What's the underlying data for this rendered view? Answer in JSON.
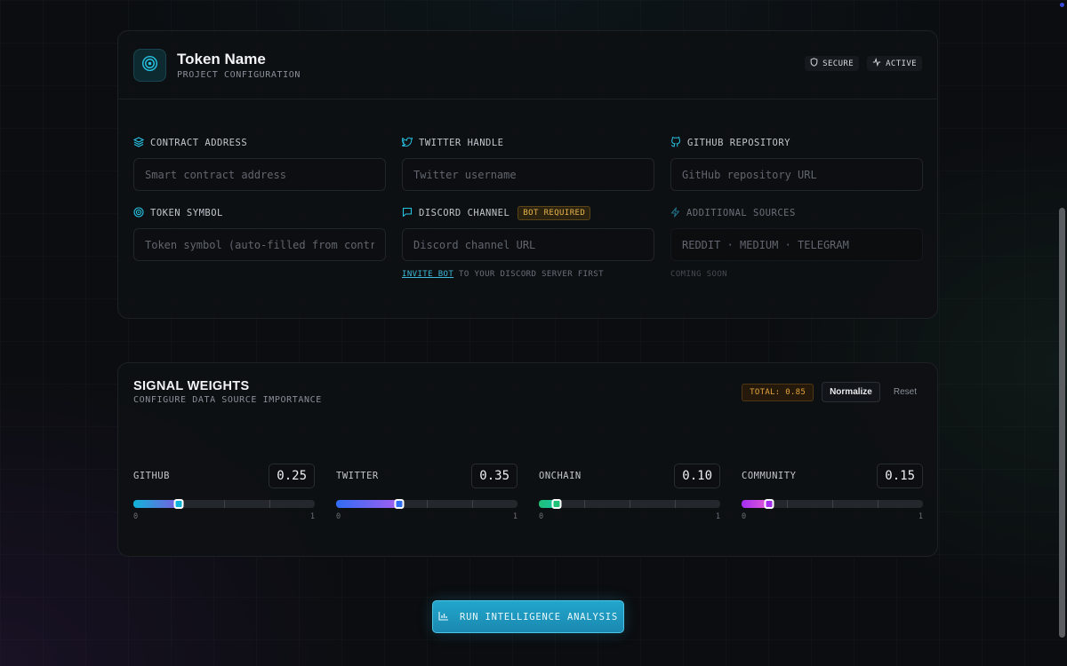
{
  "header": {
    "title": "Token Name",
    "subtitle": "PROJECT CONFIGURATION",
    "badges": [
      {
        "label": "SECURE",
        "icon": "shield-icon"
      },
      {
        "label": "ACTIVE",
        "icon": "activity-icon"
      }
    ]
  },
  "fields": {
    "contract": {
      "label": "CONTRACT ADDRESS",
      "placeholder": "Smart contract address",
      "icon": "layers-icon"
    },
    "twitter": {
      "label": "TWITTER HANDLE",
      "placeholder": "Twitter username",
      "icon": "twitter-icon"
    },
    "github": {
      "label": "GITHUB REPOSITORY",
      "placeholder": "GitHub repository URL",
      "icon": "github-icon"
    },
    "symbol": {
      "label": "TOKEN SYMBOL",
      "placeholder": "Token symbol (auto-filled from contract)",
      "icon": "target-icon"
    },
    "discord": {
      "label": "DISCORD CHANNEL",
      "badge": "BOT REQUIRED",
      "placeholder": "Discord channel URL",
      "icon": "message-icon",
      "hint_link": "INVITE BOT",
      "hint_text": " TO YOUR DISCORD SERVER FIRST"
    },
    "additional": {
      "label": "ADDITIONAL SOURCES",
      "placeholder": "REDDIT · MEDIUM · TELEGRAM",
      "hint": "COMING SOON",
      "icon": "zap-icon"
    }
  },
  "weights": {
    "title": "SIGNAL WEIGHTS",
    "subtitle": "CONFIGURE DATA SOURCE IMPORTANCE",
    "total": "TOTAL: 0.85",
    "normalize_label": "Normalize",
    "reset_label": "Reset",
    "scale_min": "0",
    "scale_max": "1",
    "items": [
      {
        "name": "GITHUB",
        "value": 0.25,
        "display": "0.25",
        "from": "#10b4d8",
        "to": "#7a5ce0"
      },
      {
        "name": "TWITTER",
        "value": 0.35,
        "display": "0.35",
        "from": "#2f6df5",
        "to": "#a45ef0"
      },
      {
        "name": "ONCHAIN",
        "value": 0.1,
        "display": "0.10",
        "from": "#1fc276",
        "to": "#19c2a0"
      },
      {
        "name": "COMMUNITY",
        "value": 0.15,
        "display": "0.15",
        "from": "#a42ef0",
        "to": "#e55bd6"
      }
    ]
  },
  "run_button": {
    "label": "RUN INTELLIGENCE ANALYSIS",
    "icon": "bar-chart-icon"
  }
}
